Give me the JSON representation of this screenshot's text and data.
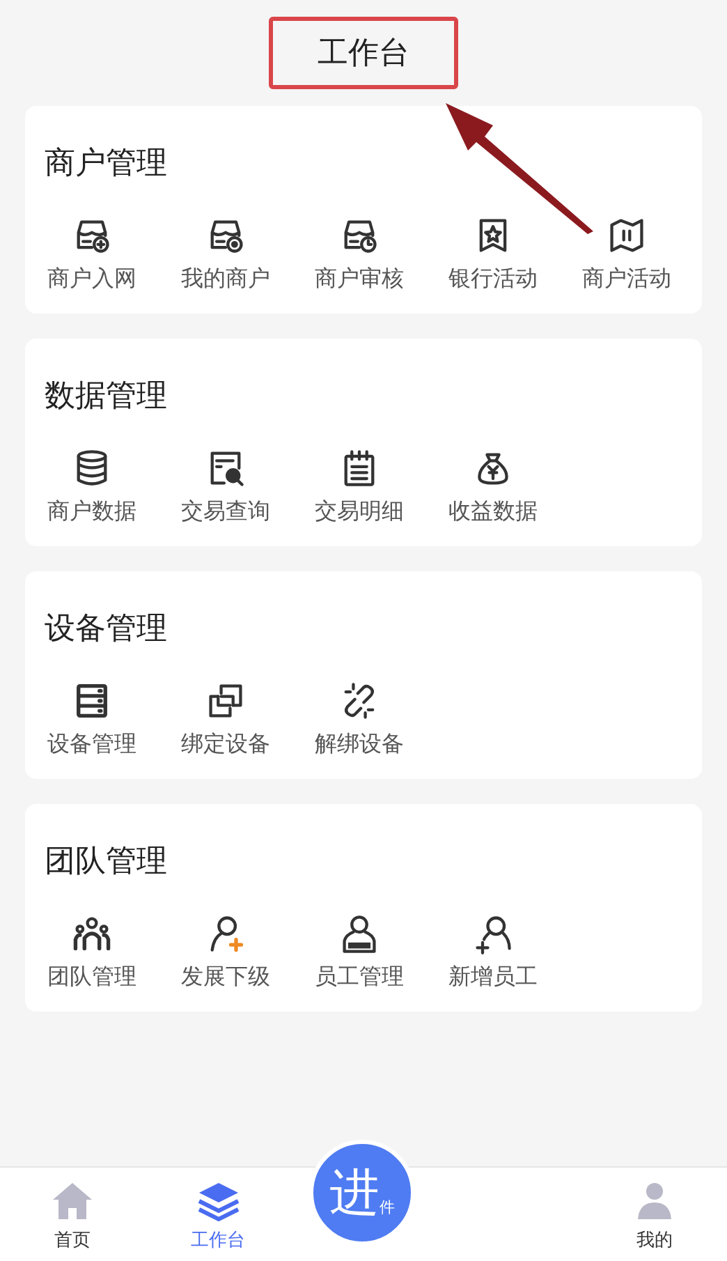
{
  "header": {
    "title": "工作台",
    "highlighted": true
  },
  "sections": [
    {
      "title": "商户管理",
      "items": [
        "商户入网",
        "我的商户",
        "商户审核",
        "银行活动",
        "商户活动"
      ]
    },
    {
      "title": "数据管理",
      "items": [
        "商户数据",
        "交易查询",
        "交易明细",
        "收益数据"
      ]
    },
    {
      "title": "设备管理",
      "items": [
        "设备管理",
        "绑定设备",
        "解绑设备"
      ]
    },
    {
      "title": "团队管理",
      "items": [
        "团队管理",
        "发展下级",
        "员工管理",
        "新增员工"
      ]
    }
  ],
  "tab_bar": {
    "tabs": [
      {
        "label": "首页",
        "selected": false
      },
      {
        "label": "工作台",
        "selected": true
      }
    ],
    "center_button": {
      "label": "进",
      "sub_label": "件"
    },
    "last_tab": {
      "label": "我的",
      "selected": false
    }
  }
}
